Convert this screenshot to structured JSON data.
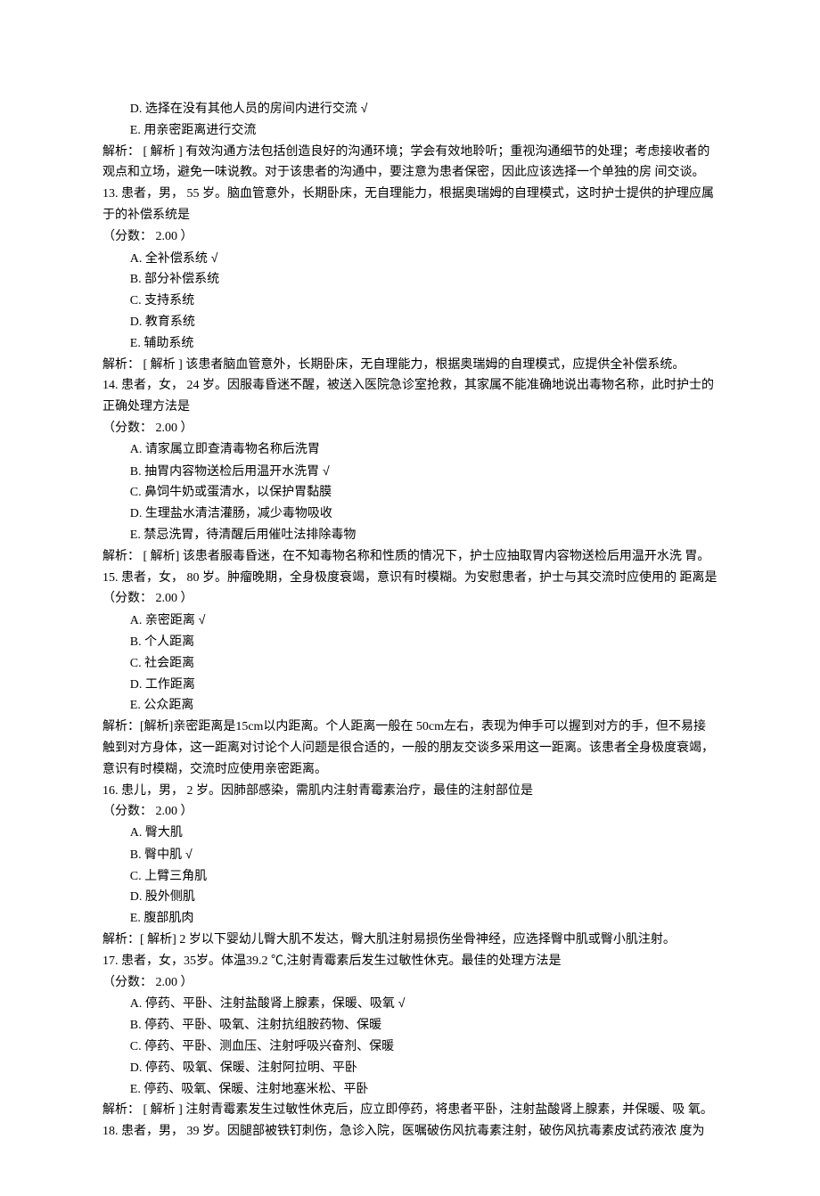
{
  "q12_tail": {
    "options": [
      {
        "label": "D.",
        "text": "选择在没有其他人员的房间内进行交流",
        "correct": true
      },
      {
        "label": "E.",
        "text": "用亲密距离进行交流",
        "correct": false
      }
    ],
    "explain": "解析： [ 解析 ] 有效沟通方法包括创造良好的沟通环境；学会有效地聆听；重视沟通细节的处理；考虑接收者的观点和立场，避免一味说教。对于该患者的沟通中，要注意为患者保密，因此应该选择一个单独的房 间交谈。"
  },
  "questions": [
    {
      "num": "13.",
      "stem": "患者，男， 55 岁。脑血管意外，长期卧床，无自理能力，根据奥瑞姆的自理模式，这时护士提供的护理应属于的补偿系统是",
      "score": "（分数： 2.00 ）",
      "options": [
        {
          "label": "A.",
          "text": "全补偿系统",
          "correct": true
        },
        {
          "label": "B.",
          "text": "部分补偿系统",
          "correct": false
        },
        {
          "label": "C.",
          "text": "支持系统",
          "correct": false
        },
        {
          "label": "D.",
          "text": "教育系统",
          "correct": false
        },
        {
          "label": "E.",
          "text": "辅助系统",
          "correct": false
        }
      ],
      "explain": "解析： [ 解析 ] 该患者脑血管意外，长期卧床，无自理能力，根据奥瑞姆的自理模式，应提供全补偿系统。"
    },
    {
      "num": "14.",
      "stem": "患者，女， 24 岁。因服毒昏迷不醒，被送入医院急诊室抢救，其家属不能准确地说出毒物名称，此时护士的正确处理方法是",
      "score": "（分数： 2.00 ）",
      "options": [
        {
          "label": "A.",
          "text": "请家属立即查清毒物名称后洗胃",
          "correct": false
        },
        {
          "label": "B.",
          "text": "抽胃内容物送检后用温开水洗胃",
          "correct": true
        },
        {
          "label": "C.",
          "text": "鼻饲牛奶或蛋清水，以保护胃黏膜",
          "correct": false
        },
        {
          "label": "D.",
          "text": "生理盐水清洁灌肠，减少毒物吸收",
          "correct": false
        },
        {
          "label": "E.",
          "text": "禁忌洗胃，待清醒后用催吐法排除毒物",
          "correct": false
        }
      ],
      "explain": "解析： [ 解析] 该患者服毒昏迷，在不知毒物名称和性质的情况下，护士应抽取胃内容物送检后用温开水洗 胃。"
    },
    {
      "num": "15.",
      "stem": "患者，女， 80 岁。肿瘤晚期，全身极度衰竭，意识有时模糊。为安慰患者，护士与其交流时应使用的 距离是",
      "score": "（分数： 2.00 ）",
      "options": [
        {
          "label": "A.",
          "text": "亲密距离",
          "correct": true
        },
        {
          "label": "B.",
          "text": "个人距离",
          "correct": false
        },
        {
          "label": "C.",
          "text": "社会距离",
          "correct": false
        },
        {
          "label": "D.",
          "text": "工作距离",
          "correct": false
        },
        {
          "label": "E.",
          "text": "公众距离",
          "correct": false
        }
      ],
      "explain": "解析：[解析]亲密距离是15cm以内距离。个人距离一般在 50cm左右，表现为伸手可以握到对方的手，但不易接触到对方身体，这一距离对讨论个人问题是很合适的，一般的朋友交谈多采用这一距离。该患者全身极度衰竭，意识有时模糊，交流时应使用亲密距离。"
    },
    {
      "num": "16.",
      "stem": "患儿，男， 2 岁。因肺部感染，需肌内注射青霉素治疗，最佳的注射部位是",
      "score": "（分数： 2.00 ）",
      "options": [
        {
          "label": "A.",
          "text": "臀大肌",
          "correct": false
        },
        {
          "label": "B.",
          "text": "臀中肌",
          "correct": true
        },
        {
          "label": "C.",
          "text": "上臂三角肌",
          "correct": false
        },
        {
          "label": "D.",
          "text": "股外侧肌",
          "correct": false
        },
        {
          "label": "E.",
          "text": "腹部肌肉",
          "correct": false
        }
      ],
      "explain": "解析：[ 解析] 2 岁以下婴幼儿臀大肌不发达，臀大肌注射易损伤坐骨神经，应选择臀中肌或臀小肌注射。"
    },
    {
      "num": "17.",
      "stem": "患者，女，35岁。体温39.2 ℃,注射青霉素后发生过敏性休克。最佳的处理方法是",
      "score": "（分数： 2.00 ）",
      "options": [
        {
          "label": "A.",
          "text": "停药、平卧、注射盐酸肾上腺素，保暖、吸氧",
          "correct": true
        },
        {
          "label": "B.",
          "text": "停药、平卧、吸氧、注射抗组胺药物、保暖",
          "correct": false
        },
        {
          "label": "C.",
          "text": "停药、平卧、测血压、注射呼吸兴奋剂、保暖",
          "correct": false
        },
        {
          "label": "D.",
          "text": "停药、吸氧、保暖、注射阿拉明、平卧",
          "correct": false
        },
        {
          "label": "E.",
          "text": "停药、吸氧、保暖、注射地塞米松、平卧",
          "correct": false
        }
      ],
      "explain": "解析： [ 解析 ] 注射青霉素发生过敏性休克后，应立即停药，将患者平卧，注射盐酸肾上腺素，并保暖、吸 氧。"
    },
    {
      "num": "18.",
      "stem": "患者，男， 39 岁。因腿部被铁钉刺伤，急诊入院，医嘱破伤风抗毒素注射，破伤风抗毒素皮试药液浓 度为",
      "score": "",
      "options": [],
      "explain": ""
    }
  ],
  "check_mark": "√"
}
